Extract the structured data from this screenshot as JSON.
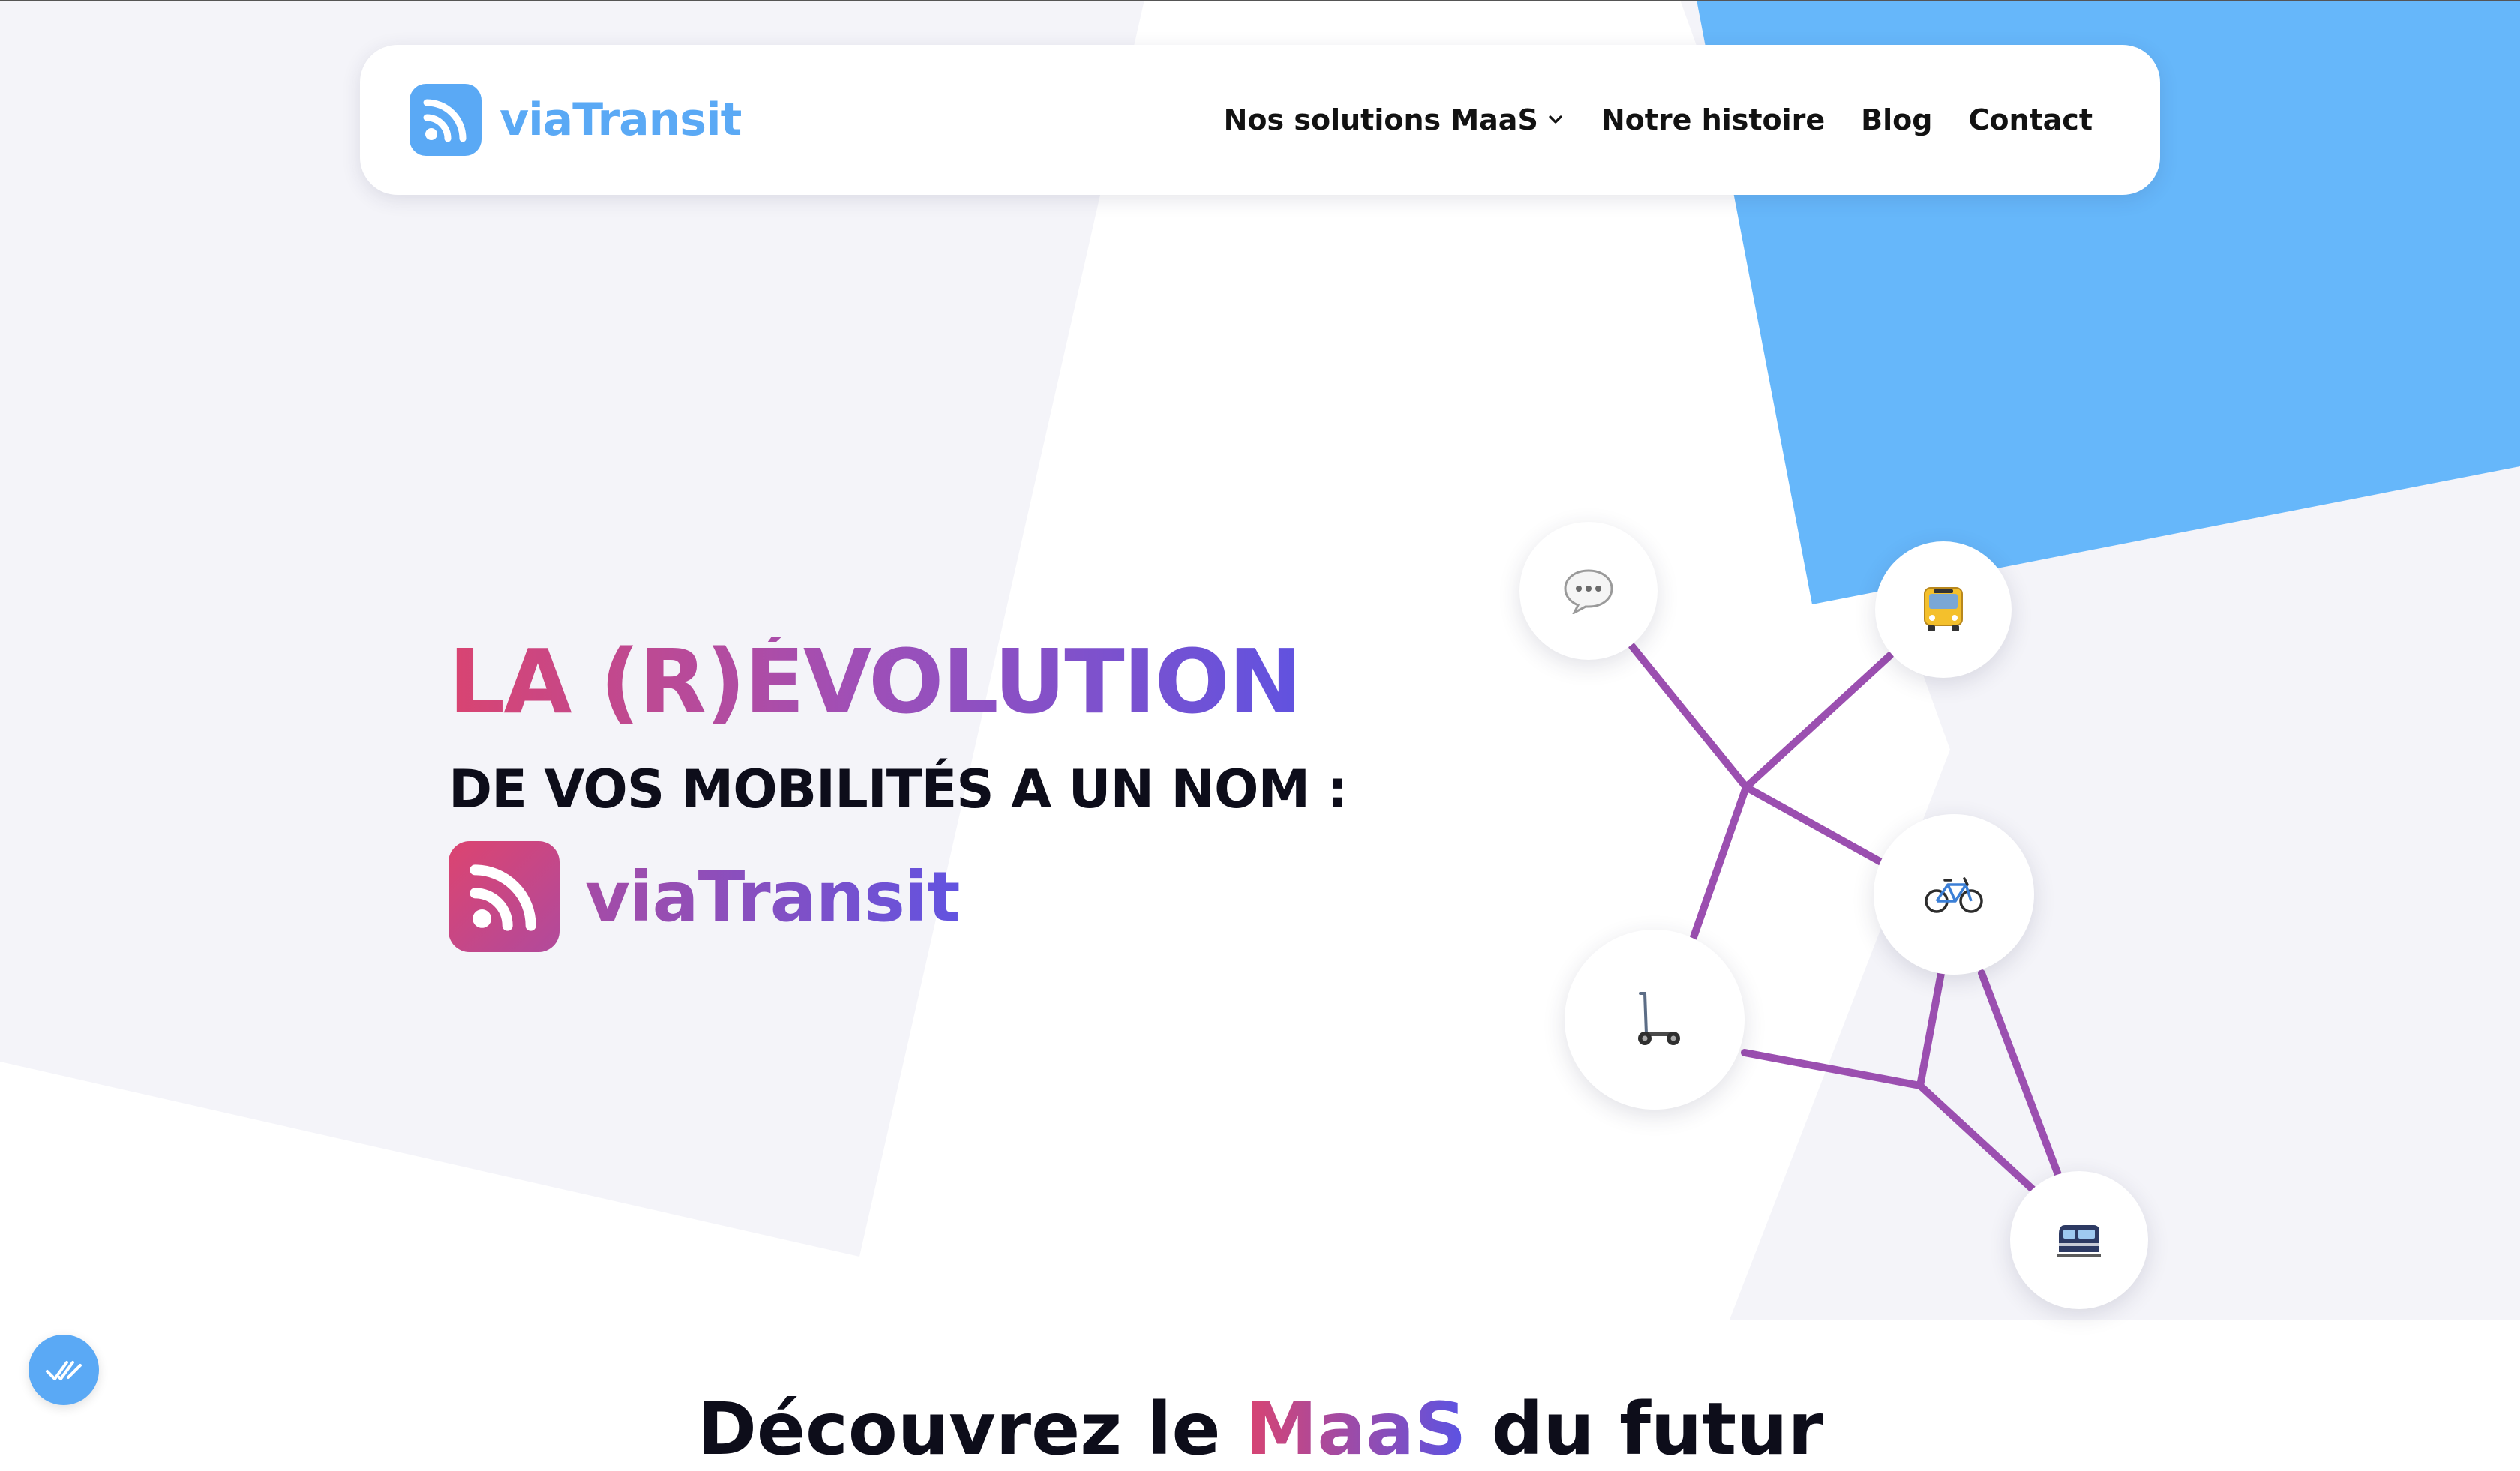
{
  "header": {
    "brand_name": "viaTransit",
    "nav": {
      "solutions_label": "Nos solutions MaaS",
      "history_label": "Notre histoire",
      "blog_label": "Blog",
      "contact_label": "Contact"
    }
  },
  "hero": {
    "title": "LA (R)ÉVOLUTION",
    "subtitle": "DE VOS MOBILITÉS A UN NOM :",
    "brand_name": "viaTransit"
  },
  "network": {
    "nodes": [
      {
        "id": "chat",
        "icon": "speech-bubble-icon"
      },
      {
        "id": "bus",
        "icon": "bus-icon"
      },
      {
        "id": "bike",
        "icon": "bicycle-icon"
      },
      {
        "id": "scooter",
        "icon": "kick-scooter-icon"
      },
      {
        "id": "train",
        "icon": "train-icon"
      }
    ],
    "line_color": "#9b4fb0"
  },
  "next_section": {
    "heading_start": "Découvrez le ",
    "heading_accent": "MaaS",
    "heading_end": " du futur"
  },
  "colors": {
    "brand_blue": "#5aa9f5",
    "gradient_pink": "#d94471",
    "gradient_violet": "#5a53e4",
    "panel_gray": "#f4f4f9"
  },
  "fab": {
    "icon": "check-marks-icon"
  }
}
